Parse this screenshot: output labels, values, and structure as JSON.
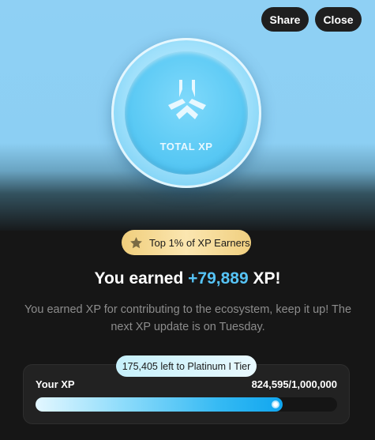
{
  "header": {
    "share_label": "Share",
    "close_label": "Close"
  },
  "medal": {
    "label": "TOTAL XP",
    "logo_icon": "total-xp-logo-icon"
  },
  "badge": {
    "icon": "star-icon",
    "text": "Top 1% of XP Earners"
  },
  "headline": {
    "prefix": "You earned ",
    "amount": "+79,889",
    "suffix": " XP!"
  },
  "description": "You earned XP for contributing to the ecosystem, keep it up! The next XP update is on Tuesday.",
  "xp_card": {
    "tier_remaining": "175,405 left to Platinum I Tier",
    "label": "Your XP",
    "count": "824,595/1,000,000",
    "current": 824595,
    "max": 1000000
  },
  "colors": {
    "accent": "#56c3f5",
    "badge_gold": "#f0ce7c",
    "background": "#161616"
  }
}
